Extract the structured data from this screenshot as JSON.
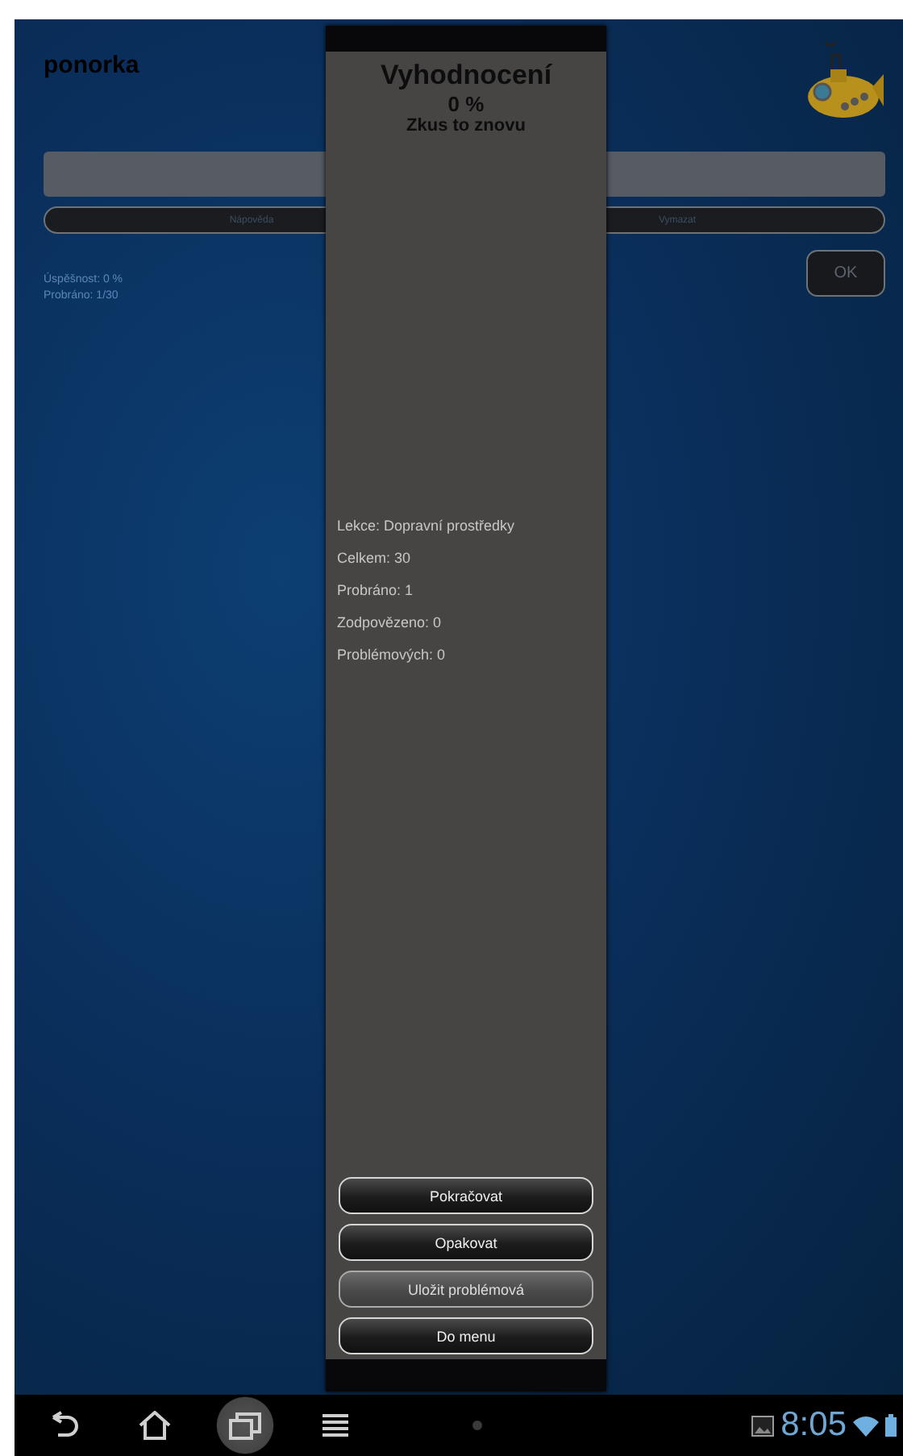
{
  "app": {
    "title": "ponorka",
    "buttons": [
      {
        "label": "Nápověda"
      },
      {
        "label": "Vymazat"
      }
    ],
    "stats": [
      "Úspěšnost: 0 %",
      "Probráno: 1/30"
    ],
    "ok_button": "OK"
  },
  "dialog": {
    "title": "Vyhodnocení",
    "score": "0 %",
    "message": "Zkus to znovu",
    "info": [
      "Lekce: Dopravní prostředky",
      "Celkem: 30",
      "Probráno: 1",
      "Zodpovězeno: 0",
      "Problémových: 0"
    ],
    "buttons": [
      {
        "label": "Pokračovat",
        "disabled": false
      },
      {
        "label": "Opakovat",
        "disabled": false
      },
      {
        "label": "Uložit problémová",
        "disabled": true
      },
      {
        "label": "Do menu",
        "disabled": false
      }
    ]
  },
  "nav_bar": {
    "buttons": [
      {
        "kind": "back",
        "selected": false
      },
      {
        "kind": "home",
        "selected": false
      },
      {
        "kind": "recent",
        "selected": true
      },
      {
        "kind": "menu",
        "selected": false
      }
    ],
    "time": "8:05"
  }
}
